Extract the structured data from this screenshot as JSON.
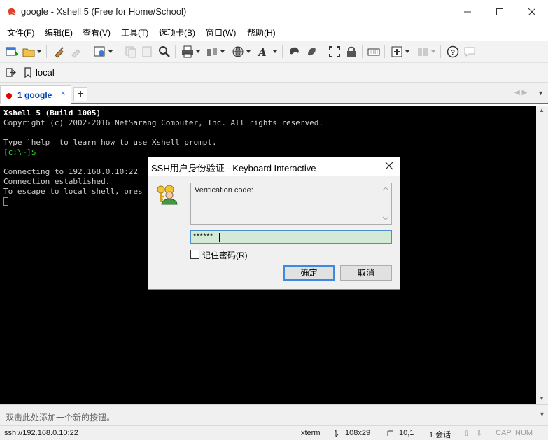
{
  "window": {
    "title": "google - Xshell 5 (Free for Home/School)"
  },
  "menu": [
    "文件(F)",
    "编辑(E)",
    "查看(V)",
    "工具(T)",
    "选项卡(B)",
    "窗口(W)",
    "帮助(H)"
  ],
  "address_bar": {
    "label": "local"
  },
  "tabs": [
    {
      "label": "1 google",
      "close": "×"
    }
  ],
  "tab_add": "+",
  "terminal": {
    "lines": [
      "Xshell 5 (Build 1005)",
      "Copyright (c) 2002-2016 NetSarang Computer, Inc. All rights reserved.",
      "",
      "Type `help' to learn how to use Xshell prompt.",
      "[c:\\~]$",
      "",
      "Connecting to 192.168.0.10:22",
      "Connection established.",
      "To escape to local shell, pres"
    ]
  },
  "hint_bar": {
    "text": "双击此处添加一个新的按钮。"
  },
  "status": {
    "connection": "ssh://192.168.0.10:22",
    "terminal_type": "xterm",
    "size": "108x29",
    "cursor": "10,1",
    "sessions": "1 会话",
    "cap": "CAP",
    "num": "NUM"
  },
  "dialog": {
    "title": "SSH用户身份验证 - Keyboard Interactive",
    "prompt": "Verification code:",
    "input_value": "******",
    "remember_label": "记住密码(R)",
    "remember_checked": false,
    "ok_label": "确定",
    "cancel_label": "取消"
  },
  "colors": {
    "accent": "#1a7fd4",
    "terminal_bg": "#000000",
    "prompt_green": "#35d035",
    "tab_dot": "#e00000"
  }
}
